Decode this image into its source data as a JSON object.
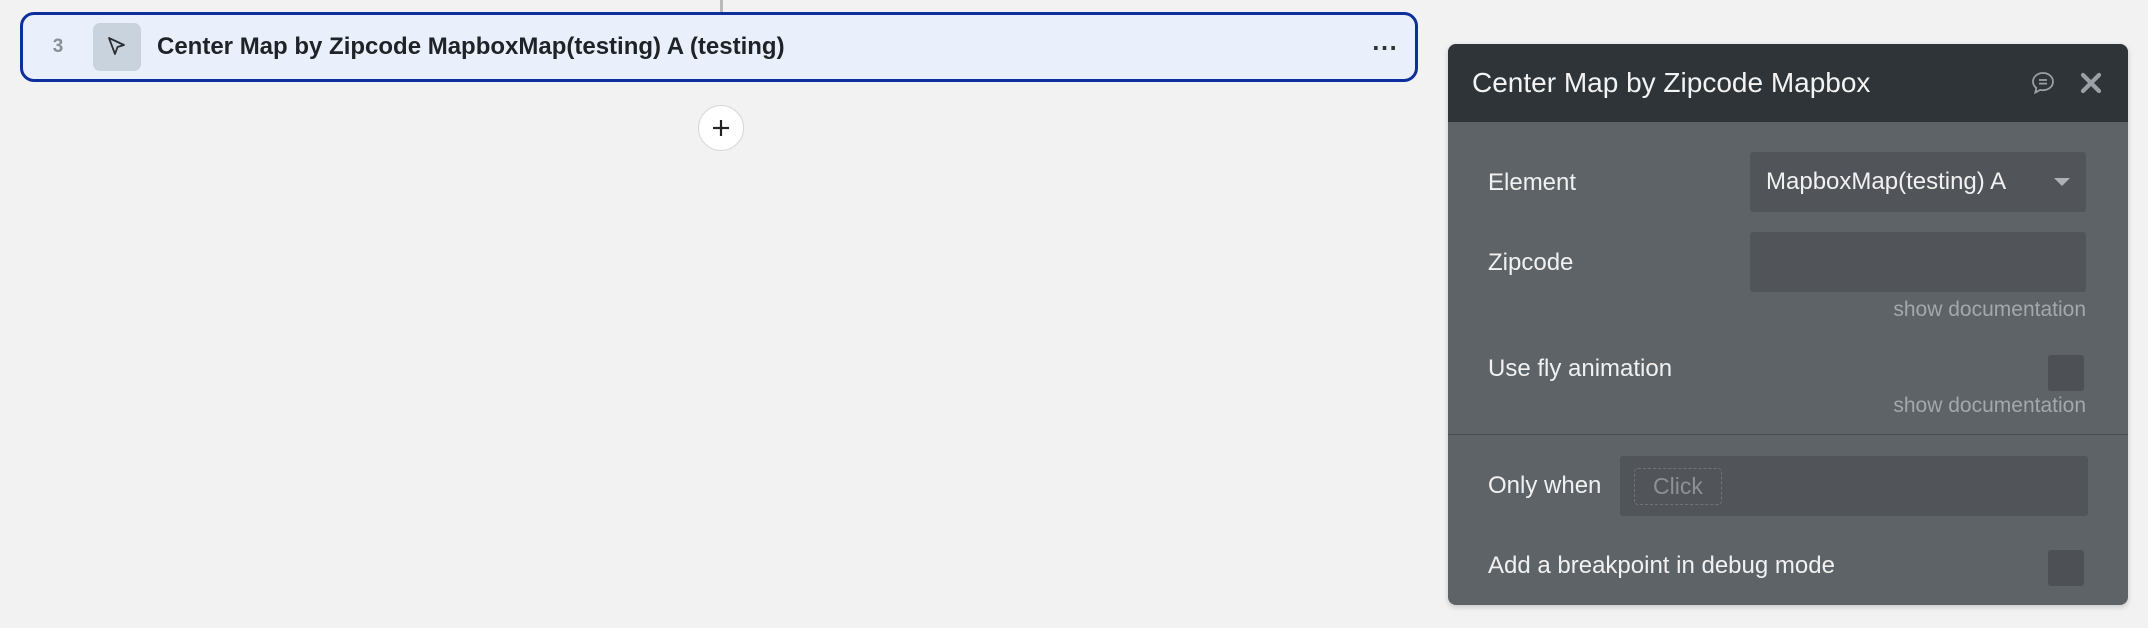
{
  "step": {
    "number": "3",
    "icon": "cursor-arrow-icon",
    "title": "Center Map by Zipcode MapboxMap(testing) A (testing)",
    "menu_label": "⋯"
  },
  "add_step_icon": "plus-icon",
  "panel": {
    "title": "Center Map by Zipcode Mapbox",
    "note_icon": "comment-icon",
    "close_icon": "close-icon",
    "fields": {
      "element_label": "Element",
      "element_value": "MapboxMap(testing) A",
      "zipcode_label": "Zipcode",
      "zipcode_value": "",
      "zipcode_doc": "show documentation",
      "fly_label": "Use fly animation",
      "fly_checked": false,
      "fly_doc": "show documentation",
      "only_when_label": "Only when",
      "only_when_placeholder": "Click",
      "breakpoint_label": "Add a breakpoint in debug mode",
      "breakpoint_checked": false
    }
  },
  "colors": {
    "card_border": "#0d2f9e",
    "card_bg": "#e9f0fb",
    "panel_header": "#2e3437",
    "panel_body": "#5e6368"
  }
}
